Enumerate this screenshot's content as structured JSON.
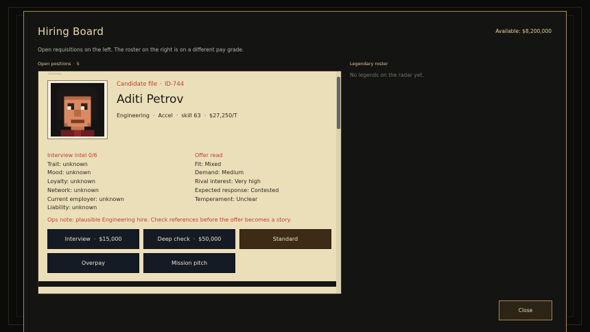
{
  "header": {
    "title": "Hiring Board",
    "available": "Available: $8,200,000",
    "subtitle": "Open requisitions on the left. The roster on the right is on a different pay grade."
  },
  "open_positions": {
    "label": "Open positions",
    "separator": "·",
    "count": "5"
  },
  "legendary": {
    "label": "Legendary roster",
    "empty_text": "No legends on the radar yet."
  },
  "candidate": {
    "file_label": "Candidate file",
    "file_sep": "·",
    "file_id": "ID-744",
    "name": "Aditi Petrov",
    "meta_sep": "·",
    "department": "Engineering",
    "role": "Accel",
    "skill": "skill 63",
    "salary": "$27,250/T",
    "portrait_icon": "pixel-face-portrait",
    "intel": {
      "heading": "Interview intel 0/6",
      "rows": [
        "Trait: unknown",
        "Mood: unknown",
        "Loyalty: unknown",
        "Network: unknown",
        "Current employer: unknown",
        "Liability: unknown"
      ]
    },
    "offer": {
      "heading": "Offer read",
      "rows": [
        "Fit: Mixed",
        "Demand: Medium",
        "Rival interest: Very high",
        "Expected response: Contested",
        "Temperament: Unclear"
      ]
    },
    "ops_note": "Ops note: plausible Engineering hire. Check references before the offer becomes a story.",
    "actions": {
      "interview_label": "Interview",
      "interview_price": "$15,000",
      "deep_check_label": "Deep check",
      "deep_check_price": "$50,000",
      "sep": "·",
      "standard": "Standard",
      "overpay": "Overpay",
      "mission_pitch": "Mission pitch"
    }
  },
  "footer": {
    "close": "Close"
  },
  "colors": {
    "accent_gold": "#b08b4f",
    "card_bg": "#ebdfb9",
    "alert_red": "#bf3e2f",
    "button_navy": "#151b25",
    "button_selected": "#3d2a17"
  }
}
